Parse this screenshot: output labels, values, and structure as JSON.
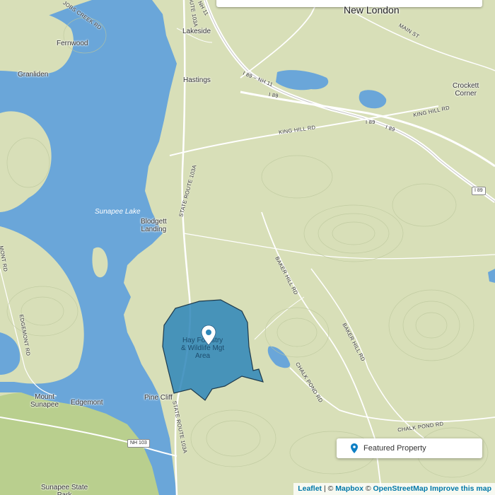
{
  "map": {
    "places": {
      "new_london": "New London",
      "fernwood": "Fernwood",
      "granliden": "Granliden",
      "lakeside": "Lakeside",
      "hastings": "Hastings",
      "crockett_corner": "Crockett\nCorner",
      "blodgett_landing": "Blodgett\nLanding",
      "sunapee_lake": "Sunapee Lake",
      "mount_sunapee": "Mount\nSunapee",
      "edgemont": "Edgemont",
      "pine_cliff": "Pine Cliff",
      "sunapee_state_park": "Sunapee State\nPark"
    },
    "roads": {
      "jobs_creek": "JOBS CREEK RD",
      "route_11": "NH 11",
      "route_103a_top": "ROUTE 103A",
      "main_st": "MAIN ST",
      "i89_nh11": "I 89 – NH 11",
      "i89_a": "I 89",
      "king_hill_rd_east": "KING HILL RD",
      "i89_b": "I 89",
      "i89_c": "I 89",
      "i89_d": "I 89",
      "king_hill_rd_mid": "KING HILL RD",
      "state_route_103a_north": "STATE ROUTE 103A",
      "baker_hill_rd": "BAKER HILL RD",
      "bakers_hill_rd": "BAKER HILL RD",
      "chalk_pond_rd_a": "CHALK POND RD",
      "chalk_pond_rd_b": "CHALK POND RD",
      "state_route_103a_south": "STATE ROUTE 103A",
      "nh_103": "NH 103",
      "edgemont_rd": "EDGEMONT RD",
      "mont_rd": "MONT RD",
      "ra_rd": "RD"
    },
    "property_label": "Hay Forestry\n& Wildlife Mgt\nArea",
    "colors": {
      "land": "#d8dfb8",
      "water": "#6aa6d9",
      "forest": "#b9cf8e",
      "property_fill": "#2e86b8",
      "property_stroke": "#1e3a4c",
      "marker": "#0e7fc4"
    }
  },
  "legend": {
    "label": "Featured Property",
    "icon": "map-pin-icon"
  },
  "attribution": {
    "leaflet": "Leaflet",
    "sep": " | © ",
    "mapbox": "Mapbox",
    "sep2": " © ",
    "osm": "OpenStreetMap",
    "improve": "Improve this map"
  }
}
